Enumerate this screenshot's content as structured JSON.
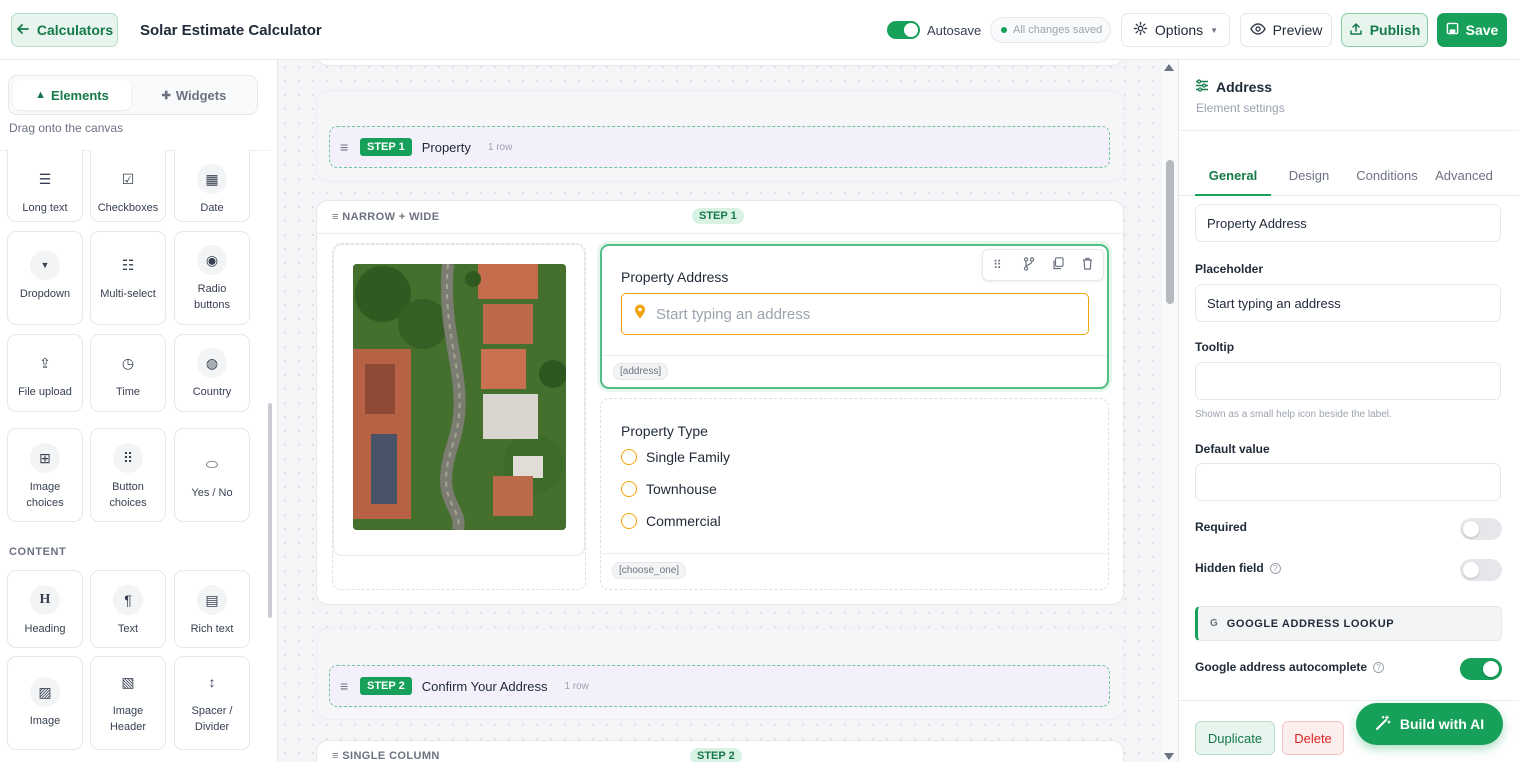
{
  "topbar": {
    "back_label": "Calculators",
    "title": "Solar Estimate Calculator",
    "autosave_label": "Autosave",
    "autosave_on": true,
    "saved_status": "All changes saved",
    "options_label": "Options",
    "preview_label": "Preview",
    "publish_label": "Publish",
    "save_label": "Save"
  },
  "sidebar": {
    "tabs": [
      "Elements",
      "Widgets"
    ],
    "hint": "Drag onto the canvas",
    "items": [
      {
        "label": "Long text",
        "icon": "align-left-icon"
      },
      {
        "label": "Checkboxes",
        "icon": "checkbox-icon"
      },
      {
        "label": "Date",
        "icon": "calendar-icon"
      },
      {
        "label": "Dropdown",
        "icon": "dropdown-icon"
      },
      {
        "label": "Multi-select",
        "icon": "checklist-icon"
      },
      {
        "label": "Radio buttons",
        "icon": "radio-icon"
      },
      {
        "label": "File upload",
        "icon": "upload-icon"
      },
      {
        "label": "Time",
        "icon": "clock-icon"
      },
      {
        "label": "Country",
        "icon": "globe-icon"
      },
      {
        "label": "Image choices",
        "icon": "grid-icon"
      },
      {
        "label": "Button choices",
        "icon": "dots-grid-icon"
      },
      {
        "label": "Yes / No",
        "icon": "toggle-icon"
      }
    ],
    "content_section": "CONTENT",
    "content_items": [
      {
        "label": "Heading",
        "icon": "heading-icon"
      },
      {
        "label": "Text",
        "icon": "paragraph-icon"
      },
      {
        "label": "Rich text",
        "icon": "document-icon"
      },
      {
        "label": "Image",
        "icon": "image-icon"
      },
      {
        "label": "Image Header",
        "icon": "image-header-icon"
      },
      {
        "label": "Spacer / Divider",
        "icon": "vertical-arrows-icon"
      }
    ]
  },
  "canvas": {
    "step1": {
      "badge": "STEP 1",
      "title": "Property",
      "rows": "1 row"
    },
    "layout1": {
      "label": "≡ NARROW + WIDE",
      "step_pill": "STEP 1"
    },
    "address_field": {
      "label": "Property Address",
      "placeholder": "Start typing an address",
      "key": "[address]"
    },
    "type_field": {
      "label": "Property Type",
      "options": [
        "Single Family",
        "Townhouse",
        "Commercial"
      ],
      "key": "[choose_one]"
    },
    "step2": {
      "badge": "STEP 2",
      "title": "Confirm Your Address",
      "rows": "1 row"
    },
    "layout2": {
      "label": "≡ SINGLE COLUMN",
      "step_pill": "STEP 2"
    }
  },
  "panel": {
    "title": "Address",
    "subtitle": "Element settings",
    "tabs": [
      "General",
      "Design",
      "Conditions",
      "Advanced"
    ],
    "label_value": "Property Address",
    "placeholder_label": "Placeholder",
    "placeholder_value": "Start typing an address",
    "tooltip_label": "Tooltip",
    "tooltip_value": "",
    "tooltip_help": "Shown as a small help icon beside the label.",
    "default_label": "Default value",
    "default_value": "",
    "required_label": "Required",
    "required_on": false,
    "hidden_label": "Hidden field",
    "hidden_on": false,
    "lookup_section": "GOOGLE ADDRESS LOOKUP",
    "autocomplete_label": "Google address autocomplete",
    "autocomplete_on": true,
    "duplicate_label": "Duplicate",
    "delete_label": "Delete",
    "ai_label": "Build with AI"
  },
  "colors": {
    "brand": "#16a05a",
    "brand_dark": "#16794a",
    "warning": "#f0a30a",
    "danger": "#dc2626"
  }
}
